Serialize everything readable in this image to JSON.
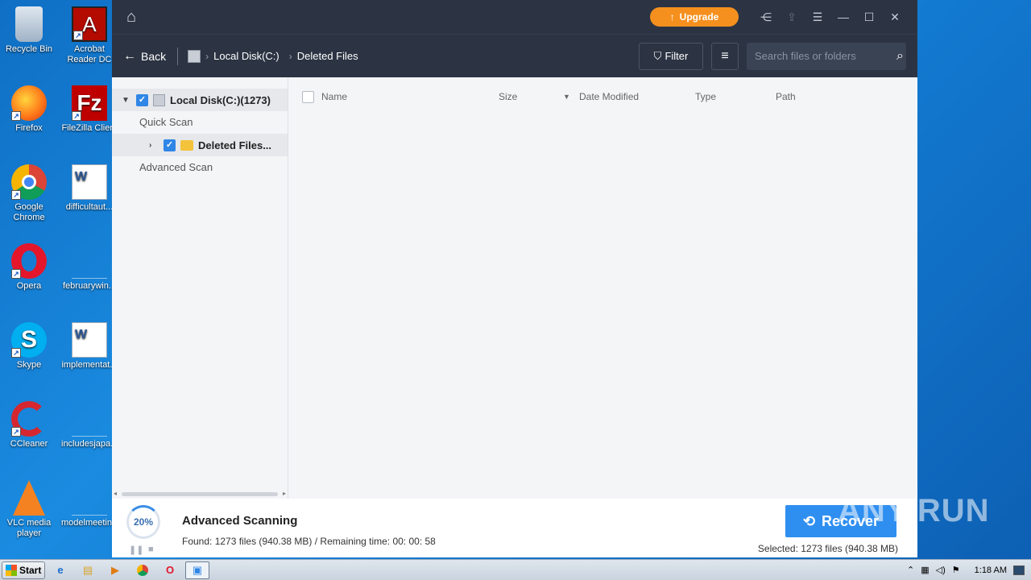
{
  "desktop": {
    "icons": [
      {
        "label": "Recycle Bin"
      },
      {
        "label": "Acrobat Reader DC"
      },
      {
        "label": "Firefox"
      },
      {
        "label": "FileZilla Client"
      },
      {
        "label": "Google Chrome"
      },
      {
        "label": "difficultaut..."
      },
      {
        "label": "Opera"
      },
      {
        "label": "februarywin..."
      },
      {
        "label": "Skype"
      },
      {
        "label": "implementat..."
      },
      {
        "label": "CCleaner"
      },
      {
        "label": "includesjapa..."
      },
      {
        "label": "VLC media player"
      },
      {
        "label": "modelmeetin..."
      }
    ]
  },
  "titlebar": {
    "upgrade_label": "Upgrade"
  },
  "nav": {
    "back_label": "Back",
    "crumbs": [
      "Local Disk(C:)",
      "Deleted Files"
    ],
    "filter_label": "Filter",
    "search_placeholder": "Search files or folders"
  },
  "sidebar": {
    "root_label": "Local Disk(C:)(1273)",
    "quick_scan": "Quick Scan",
    "deleted_files": "Deleted Files...",
    "advanced_scan": "Advanced Scan"
  },
  "table": {
    "columns": [
      "Name",
      "Size",
      "Date Modified",
      "Type",
      "Path"
    ]
  },
  "footer": {
    "progress_text": "20%",
    "progress": 0.2,
    "title": "Advanced Scanning",
    "info": "Found: 1273 files (940.38 MB) / Remaining time: 00: 00: 58",
    "recover_label": "Recover",
    "selected": "Selected: 1273 files (940.38 MB)"
  },
  "taskbar": {
    "start_label": "Start",
    "time": "1:18 AM"
  },
  "watermark": "ANY RUN"
}
